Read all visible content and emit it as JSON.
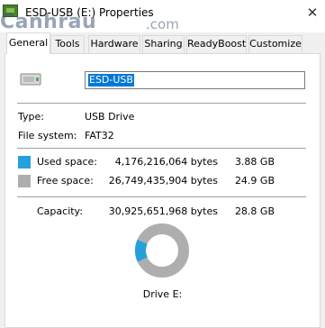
{
  "window": {
    "title": "ESD-USB (E:) Properties",
    "close_glyph": "✕",
    "watermark": "Canhrau",
    "watermark_suffix": ".com"
  },
  "tabs": [
    {
      "label": "General",
      "active": true
    },
    {
      "label": "Tools"
    },
    {
      "label": "Hardware"
    },
    {
      "label": "Sharing"
    },
    {
      "label": "ReadyBoost"
    },
    {
      "label": "Customize"
    }
  ],
  "general": {
    "volume_name": "ESD-USB",
    "type_label": "Type:",
    "type_value": "USB Drive",
    "fs_label": "File system:",
    "fs_value": "FAT32",
    "used": {
      "label": "Used space:",
      "bytes": "4,176,216,064 bytes",
      "size": "3.88 GB",
      "color": "#26a0da"
    },
    "free": {
      "label": "Free space:",
      "bytes": "26,749,435,904 bytes",
      "size": "24.9 GB",
      "color": "#aeaeae"
    },
    "capacity": {
      "label": "Capacity:",
      "bytes": "30,925,651,968 bytes",
      "size": "28.8 GB"
    },
    "drive_label": "Drive E:",
    "used_fraction": 0.135
  }
}
